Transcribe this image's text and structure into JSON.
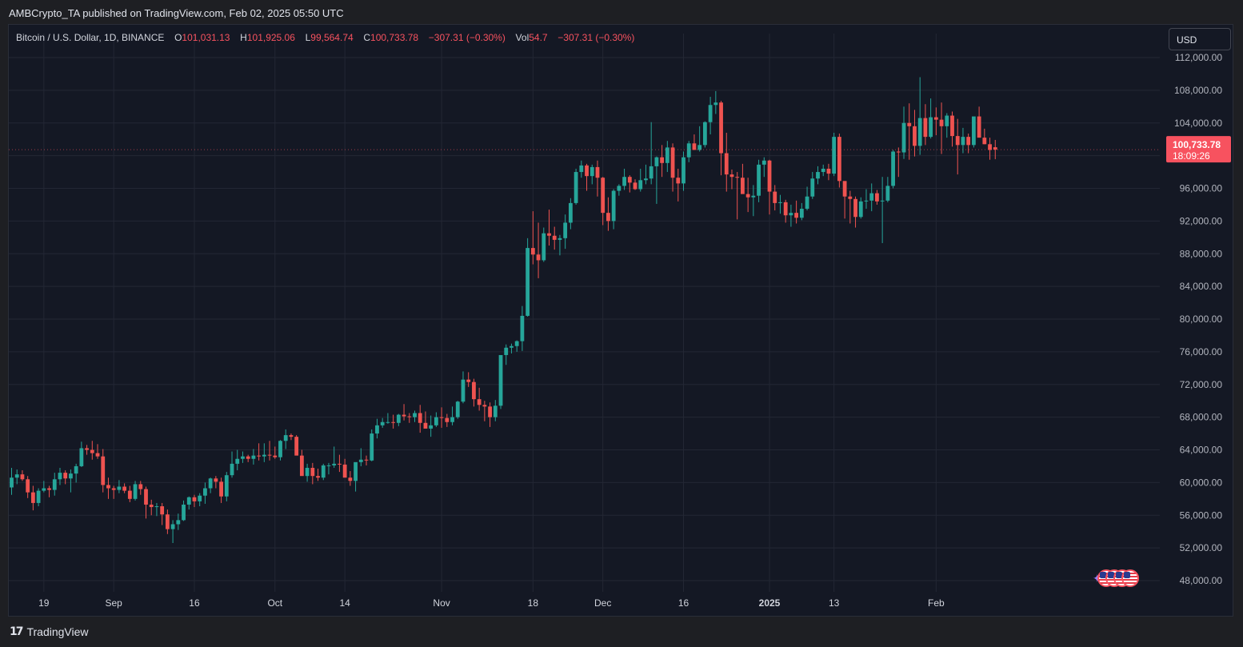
{
  "header": {
    "publish_line": "AMBCrypto_TA published on TradingView.com, Feb 02, 2025 05:50 UTC"
  },
  "legend": {
    "symbol": "Bitcoin / U.S. Dollar, 1D, BINANCE",
    "o_label": "O",
    "o_value": "101,031.13",
    "h_label": "H",
    "h_value": "101,925.06",
    "l_label": "L",
    "l_value": "99,564.74",
    "c_label": "C",
    "c_value": "100,733.78",
    "change": "−307.31 (−0.30%)",
    "vol_label": "Vol",
    "vol_value": "54.7",
    "vol_change": "−307.31 (−0.30%)"
  },
  "currency_button": {
    "label": "USD"
  },
  "price_tag": {
    "price": "100,733.78",
    "countdown": "18:09:26",
    "value": 100733.78
  },
  "footer": {
    "brand": "TradingView",
    "logo_mark": "17"
  },
  "colors": {
    "up": "#26a69a",
    "down": "#ef5350",
    "background": "#141824",
    "grid": "#232734",
    "axis_text": "#b2b5be",
    "price_tag_bg": "#f7525f"
  },
  "events": {
    "icons": [
      "us-flag-icon",
      "us-flag-icon",
      "us-flag-icon",
      "us-flag-icon"
    ],
    "sparkle_icon": "sparkle-icon"
  },
  "chart_data": {
    "type": "candlestick",
    "title": "Bitcoin / U.S. Dollar, 1D, BINANCE",
    "xlabel": "",
    "ylabel": "",
    "ylim": [
      47000,
      113000
    ],
    "grid": true,
    "y_ticks": [
      112000,
      108000,
      104000,
      100000,
      96000,
      92000,
      88000,
      84000,
      80000,
      76000,
      72000,
      68000,
      64000,
      60000,
      56000,
      52000,
      48000
    ],
    "y_tick_labels": [
      "112,000.00",
      "108,000.00",
      "104,000.00",
      "",
      "96,000.00",
      "92,000.00",
      "88,000.00",
      "84,000.00",
      "80,000.00",
      "76,000.00",
      "72,000.00",
      "68,000.00",
      "64,000.00",
      "60,000.00",
      "56,000.00",
      "52,000.00",
      "48,000.00"
    ],
    "x_ticks": [
      {
        "label": "19",
        "day": 6,
        "bold": false
      },
      {
        "label": "Sep",
        "day": 19,
        "bold": false
      },
      {
        "label": "16",
        "day": 34,
        "bold": false
      },
      {
        "label": "Oct",
        "day": 49,
        "bold": false
      },
      {
        "label": "14",
        "day": 62,
        "bold": false
      },
      {
        "label": "Nov",
        "day": 80,
        "bold": false
      },
      {
        "label": "18",
        "day": 97,
        "bold": false
      },
      {
        "label": "Dec",
        "day": 110,
        "bold": false
      },
      {
        "label": "16",
        "day": 125,
        "bold": false
      },
      {
        "label": "2025",
        "day": 141,
        "bold": true
      },
      {
        "label": "13",
        "day": 153,
        "bold": false
      },
      {
        "label": "Feb",
        "day": 172,
        "bold": false
      }
    ],
    "first_date": "2024-08-14",
    "candles": [
      [
        59400,
        61800,
        58500,
        60600
      ],
      [
        60600,
        61600,
        59800,
        61000
      ],
      [
        61000,
        61500,
        60200,
        60400
      ],
      [
        60400,
        60800,
        58100,
        58800
      ],
      [
        58800,
        59600,
        56600,
        57500
      ],
      [
        57500,
        59300,
        57100,
        59000
      ],
      [
        59000,
        60200,
        58800,
        59300
      ],
      [
        59300,
        59600,
        58200,
        59100
      ],
      [
        59100,
        61200,
        58400,
        60400
      ],
      [
        60400,
        61800,
        59700,
        61200
      ],
      [
        61200,
        61500,
        59800,
        60500
      ],
      [
        60500,
        61600,
        58800,
        61100
      ],
      [
        61100,
        62300,
        60000,
        62000
      ],
      [
        62000,
        65000,
        61900,
        64200
      ],
      [
        64200,
        64600,
        63400,
        64000
      ],
      [
        64000,
        65100,
        62800,
        63600
      ],
      [
        63600,
        64700,
        62900,
        63200
      ],
      [
        63200,
        64100,
        58800,
        59700
      ],
      [
        59700,
        60600,
        58000,
        59300
      ],
      [
        59300,
        59600,
        58000,
        59100
      ],
      [
        59100,
        60300,
        58700,
        59500
      ],
      [
        59500,
        59900,
        58700,
        59000
      ],
      [
        59000,
        59600,
        57600,
        58000
      ],
      [
        58000,
        60200,
        57800,
        59800
      ],
      [
        59800,
        60200,
        58500,
        59200
      ],
      [
        59200,
        59500,
        55600,
        57300
      ],
      [
        57300,
        57900,
        56000,
        57000
      ],
      [
        57000,
        57500,
        55900,
        57100
      ],
      [
        57100,
        57500,
        54800,
        56100
      ],
      [
        56100,
        56700,
        53700,
        54300
      ],
      [
        54300,
        55400,
        52600,
        54900
      ],
      [
        54900,
        56200,
        54200,
        55400
      ],
      [
        55400,
        57800,
        55300,
        57300
      ],
      [
        57300,
        58300,
        56700,
        58200
      ],
      [
        58200,
        58500,
        57000,
        57700
      ],
      [
        57700,
        58700,
        57100,
        58400
      ],
      [
        58400,
        60000,
        57400,
        59300
      ],
      [
        59300,
        60600,
        58700,
        60500
      ],
      [
        60500,
        60800,
        59300,
        60100
      ],
      [
        60100,
        60600,
        57500,
        58300
      ],
      [
        58300,
        61300,
        57700,
        60900
      ],
      [
        60900,
        63800,
        60600,
        62300
      ],
      [
        62300,
        64000,
        61500,
        62900
      ],
      [
        62900,
        63800,
        62400,
        63200
      ],
      [
        63200,
        63400,
        62500,
        62900
      ],
      [
        62900,
        64100,
        62200,
        63300
      ],
      [
        63300,
        64800,
        62700,
        63200
      ],
      [
        63200,
        64800,
        62500,
        63400
      ],
      [
        63400,
        65100,
        62700,
        63300
      ],
      [
        63300,
        64400,
        62900,
        63100
      ],
      [
        63100,
        65200,
        62700,
        65100
      ],
      [
        65100,
        66500,
        64100,
        65800
      ],
      [
        65800,
        66000,
        65200,
        65600
      ],
      [
        65600,
        65800,
        63700,
        63300
      ],
      [
        63300,
        64000,
        60900,
        60800
      ],
      [
        60800,
        62300,
        60100,
        61800
      ],
      [
        61800,
        62400,
        59800,
        60800
      ],
      [
        60800,
        61700,
        60200,
        60600
      ],
      [
        60600,
        62300,
        60300,
        62100
      ],
      [
        62100,
        62400,
        61000,
        62100
      ],
      [
        62100,
        64400,
        61800,
        62300
      ],
      [
        62300,
        63400,
        61300,
        62200
      ],
      [
        62200,
        62900,
        60800,
        60600
      ],
      [
        60600,
        61400,
        59600,
        60200
      ],
      [
        60200,
        61300,
        58900,
        62500
      ],
      [
        62500,
        64200,
        62000,
        62800
      ],
      [
        62800,
        63300,
        62100,
        62700
      ],
      [
        62700,
        66500,
        62600,
        66000
      ],
      [
        66000,
        67800,
        65400,
        67000
      ],
      [
        67000,
        67900,
        66700,
        67400
      ],
      [
        67400,
        68500,
        67200,
        67400
      ],
      [
        67400,
        68300,
        66600,
        67300
      ],
      [
        67300,
        68400,
        66900,
        68300
      ],
      [
        68300,
        69600,
        67600,
        68100
      ],
      [
        68100,
        68500,
        67300,
        68000
      ],
      [
        68000,
        68800,
        67400,
        68500
      ],
      [
        68500,
        69500,
        66100,
        67300
      ],
      [
        67300,
        68700,
        66800,
        66600
      ],
      [
        66600,
        68200,
        65600,
        67000
      ],
      [
        67000,
        68600,
        66800,
        68000
      ],
      [
        68000,
        69200,
        66700,
        67900
      ],
      [
        67900,
        68400,
        66800,
        67400
      ],
      [
        67400,
        69300,
        67000,
        68000
      ],
      [
        68000,
        70000,
        67800,
        69900
      ],
      [
        69900,
        73600,
        69700,
        72600
      ],
      [
        72600,
        73500,
        71700,
        72300
      ],
      [
        72300,
        72700,
        69300,
        70200
      ],
      [
        70200,
        71600,
        68800,
        69500
      ],
      [
        69500,
        70000,
        67500,
        69300
      ],
      [
        69300,
        69800,
        66800,
        68000
      ],
      [
        68000,
        70100,
        67500,
        69400
      ],
      [
        69400,
        75000,
        69000,
        75600
      ],
      [
        75600,
        76900,
        74400,
        76500
      ],
      [
        76500,
        77000,
        75800,
        76700
      ],
      [
        76700,
        77400,
        76000,
        77300
      ],
      [
        77300,
        81600,
        76100,
        80400
      ],
      [
        80400,
        89900,
        80300,
        88700
      ],
      [
        88700,
        93200,
        86700,
        87900
      ],
      [
        87900,
        91800,
        85000,
        87200
      ],
      [
        87200,
        91200,
        87000,
        90500
      ],
      [
        90500,
        93400,
        89000,
        90200
      ],
      [
        90200,
        91300,
        88500,
        89700
      ],
      [
        89700,
        90300,
        87800,
        89900
      ],
      [
        89900,
        92800,
        88600,
        91800
      ],
      [
        91800,
        94800,
        91000,
        94200
      ],
      [
        94200,
        98400,
        94000,
        98000
      ],
      [
        98000,
        99400,
        97300,
        98800
      ],
      [
        98800,
        99000,
        95700,
        97500
      ],
      [
        97500,
        98900,
        96500,
        98600
      ],
      [
        98600,
        99400,
        95000,
        97300
      ],
      [
        97300,
        97400,
        91500,
        93000
      ],
      [
        93000,
        94900,
        90800,
        92000
      ],
      [
        92000,
        95900,
        91000,
        95700
      ],
      [
        95700,
        96500,
        95100,
        96300
      ],
      [
        96300,
        98400,
        95800,
        97400
      ],
      [
        97400,
        97600,
        95500,
        96700
      ],
      [
        96700,
        97100,
        95800,
        95900
      ],
      [
        95900,
        98400,
        95600,
        97000
      ],
      [
        97000,
        98900,
        96500,
        97200
      ],
      [
        97200,
        104100,
        96500,
        98700
      ],
      [
        98700,
        99900,
        94100,
        99800
      ],
      [
        99800,
        101300,
        97400,
        99100
      ],
      [
        99100,
        101800,
        98000,
        101000
      ],
      [
        101000,
        101500,
        95600,
        97300
      ],
      [
        97300,
        98400,
        94400,
        96600
      ],
      [
        96600,
        100500,
        95700,
        99800
      ],
      [
        99800,
        101800,
        99200,
        101500
      ],
      [
        101500,
        102600,
        100900,
        100700
      ],
      [
        100700,
        103600,
        100500,
        101300
      ],
      [
        101300,
        104200,
        101000,
        104100
      ],
      [
        104100,
        107200,
        102600,
        106200
      ],
      [
        106200,
        107900,
        105100,
        106500
      ],
      [
        106500,
        106700,
        97600,
        100300
      ],
      [
        100300,
        102800,
        95600,
        97700
      ],
      [
        97700,
        98300,
        95900,
        97400
      ],
      [
        97400,
        98000,
        92200,
        97300
      ],
      [
        97300,
        99000,
        96400,
        95300
      ],
      [
        95300,
        97300,
        93100,
        94900
      ],
      [
        94900,
        96400,
        92600,
        95100
      ],
      [
        95100,
        99500,
        94300,
        98900
      ],
      [
        98900,
        99800,
        97400,
        99400
      ],
      [
        99400,
        99500,
        92800,
        95600
      ],
      [
        95600,
        96400,
        93300,
        94200
      ],
      [
        94200,
        95200,
        92900,
        94300
      ],
      [
        94300,
        94600,
        91800,
        92700
      ],
      [
        92700,
        94000,
        91300,
        93000
      ],
      [
        93000,
        94500,
        91700,
        92400
      ],
      [
        92400,
        94200,
        92100,
        93500
      ],
      [
        93500,
        96200,
        93300,
        95000
      ],
      [
        95000,
        98000,
        94700,
        97200
      ],
      [
        97200,
        98700,
        96500,
        98000
      ],
      [
        98000,
        98900,
        97500,
        98400
      ],
      [
        98400,
        99000,
        97000,
        97800
      ],
      [
        97800,
        102800,
        97500,
        102300
      ],
      [
        102300,
        102700,
        96100,
        96900
      ],
      [
        96900,
        96500,
        92300,
        95000
      ],
      [
        95000,
        95700,
        91700,
        94700
      ],
      [
        94700,
        95000,
        91200,
        92500
      ],
      [
        92500,
        94900,
        92300,
        94400
      ],
      [
        94400,
        95900,
        93500,
        94500
      ],
      [
        94500,
        96600,
        93200,
        95400
      ],
      [
        95400,
        95800,
        94000,
        94400
      ],
      [
        94400,
        97400,
        89300,
        94500
      ],
      [
        94500,
        97400,
        94300,
        96300
      ],
      [
        96300,
        100700,
        96000,
        100500
      ],
      [
        100500,
        101000,
        97400,
        100400
      ],
      [
        100400,
        106000,
        99600,
        104000
      ],
      [
        104000,
        106400,
        99500,
        103600
      ],
      [
        103600,
        105600,
        99900,
        101200
      ],
      [
        101200,
        109600,
        100100,
        104600
      ],
      [
        104600,
        106300,
        101300,
        102300
      ],
      [
        102300,
        107000,
        102100,
        104700
      ],
      [
        104700,
        105900,
        102500,
        104400
      ],
      [
        104400,
        106500,
        100200,
        103600
      ],
      [
        103600,
        105200,
        102200,
        104900
      ],
      [
        104900,
        105400,
        101100,
        102400
      ],
      [
        102400,
        104500,
        97700,
        101300
      ],
      [
        101300,
        103400,
        100300,
        102300
      ],
      [
        102300,
        102700,
        100300,
        101300
      ],
      [
        101300,
        103900,
        101000,
        104800
      ],
      [
        104800,
        106000,
        102800,
        102200
      ],
      [
        102200,
        103300,
        101400,
        101400
      ],
      [
        101400,
        102200,
        99500,
        100700
      ],
      [
        101031,
        101925,
        99565,
        100734
      ]
    ]
  }
}
